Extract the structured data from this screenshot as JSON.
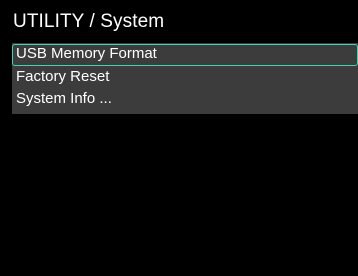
{
  "header": {
    "title": "UTILITY / System"
  },
  "menu": {
    "items": [
      {
        "label": "USB Memory Format",
        "selected": true
      },
      {
        "label": "Factory Reset",
        "selected": false
      },
      {
        "label": "System Info ...",
        "selected": false
      }
    ]
  },
  "colors": {
    "background": "#000000",
    "menu_background": "#3c3c3c",
    "selection_border": "#3fd4b4",
    "text": "#ffffff"
  }
}
